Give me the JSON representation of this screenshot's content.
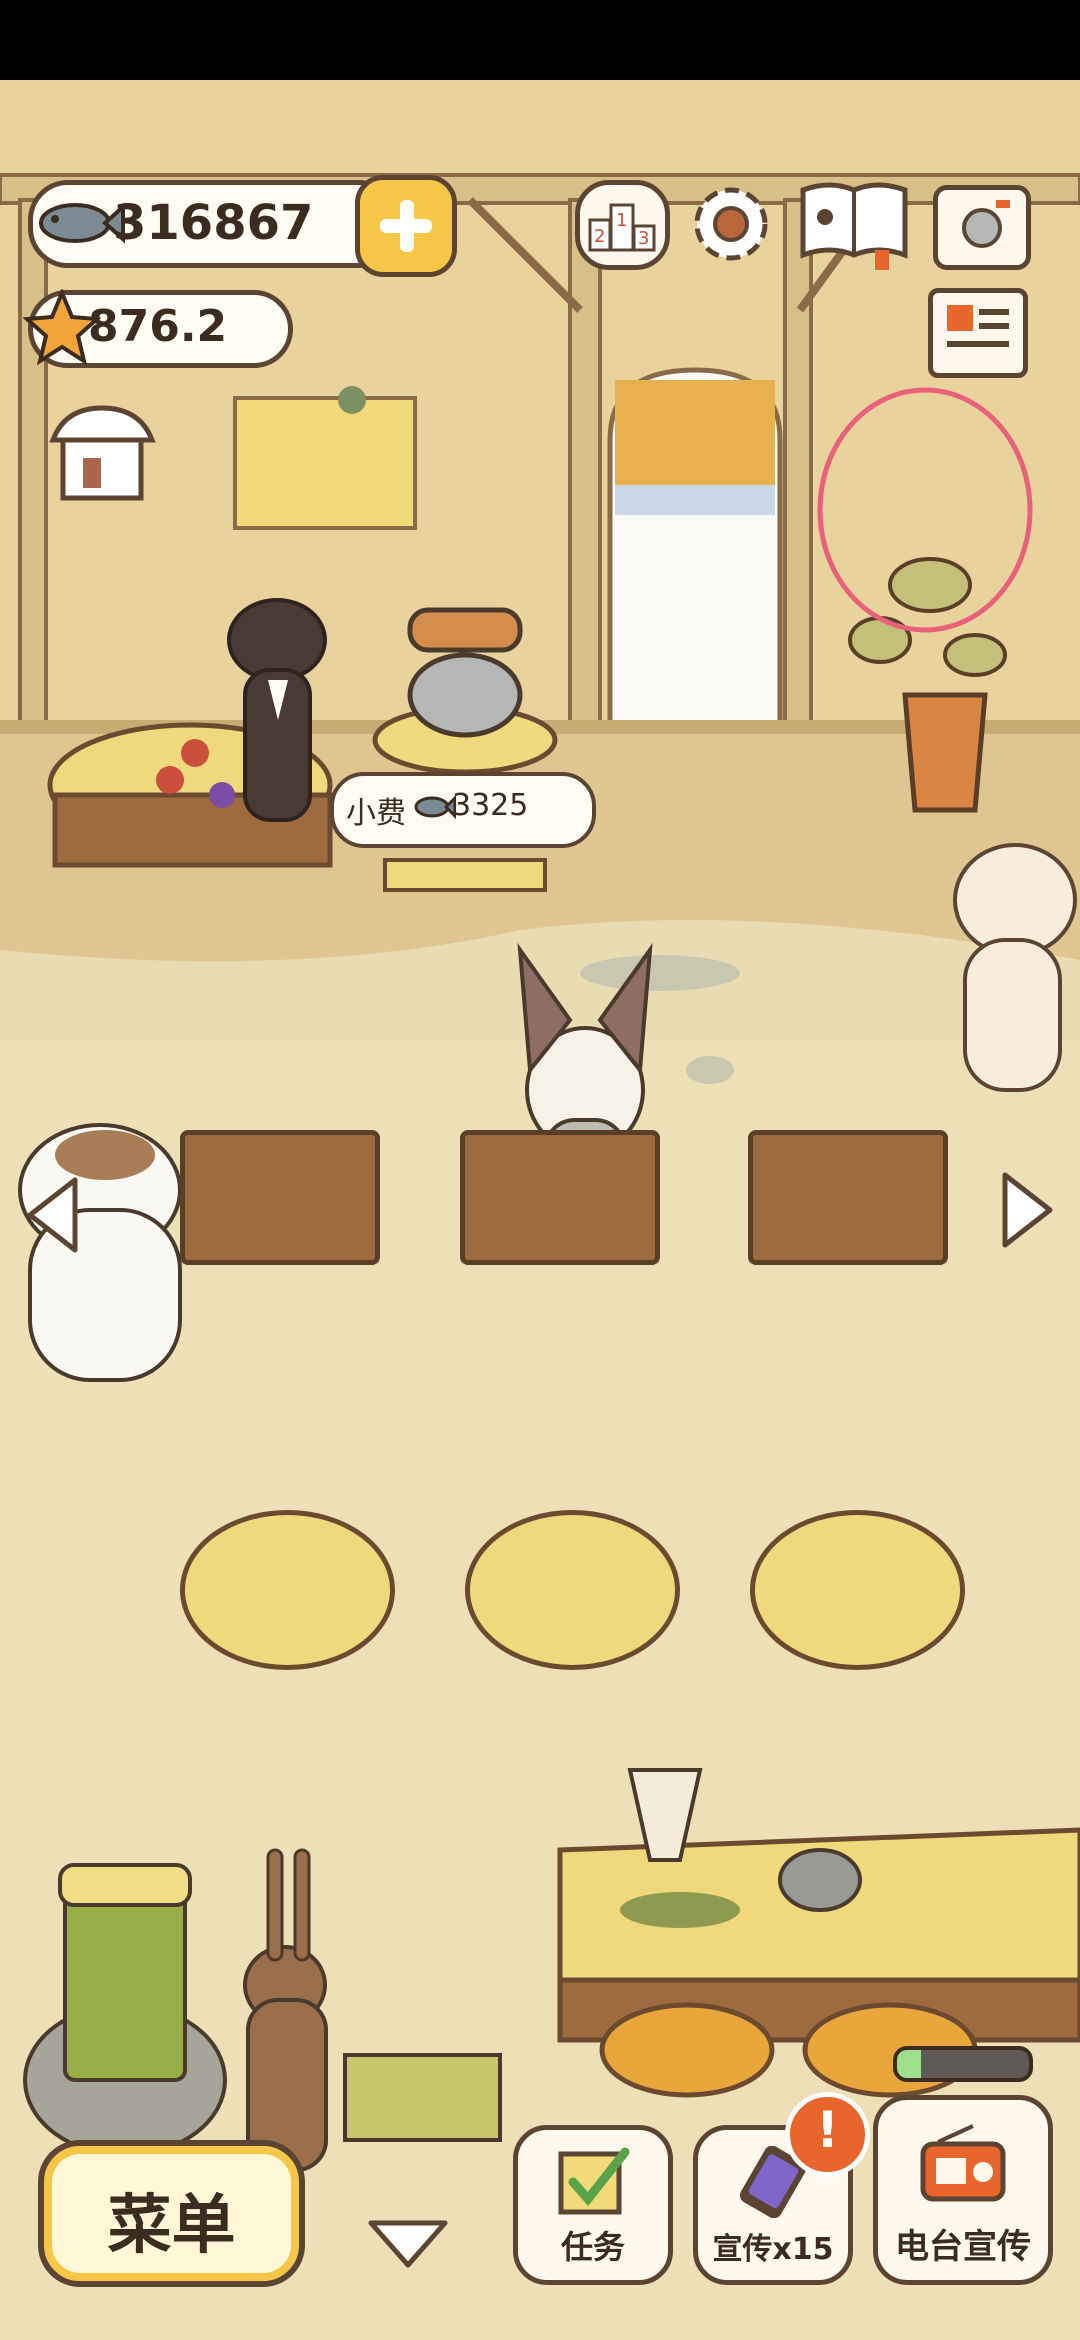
{
  "currency": {
    "fish": "316867",
    "stars": "876.2"
  },
  "tip_bubble": {
    "label": "小费",
    "amount": "3325"
  },
  "bottom_bar": {
    "menu_label": "菜单",
    "tasks_label": "任务",
    "promo_label": "宣传x15",
    "radio_label": "电台宣传",
    "promo_badge": "!"
  },
  "icons": [
    "fish-icon",
    "plus-icon",
    "star-icon",
    "ranking-icon",
    "settings-gear-icon",
    "book-icon",
    "camera-icon",
    "newspaper-icon",
    "shop-icon",
    "left-arrow-icon",
    "right-arrow-icon",
    "down-arrow-icon",
    "checklist-icon",
    "phone-promo-icon",
    "radio-icon"
  ],
  "colors": {
    "accent_yellow": "#f6c646",
    "outline_brown": "#5b4432",
    "badge_orange": "#e8652b",
    "annotation_circle": "#e8607a"
  },
  "progress": {
    "bar_fill_fraction": 0.18
  }
}
